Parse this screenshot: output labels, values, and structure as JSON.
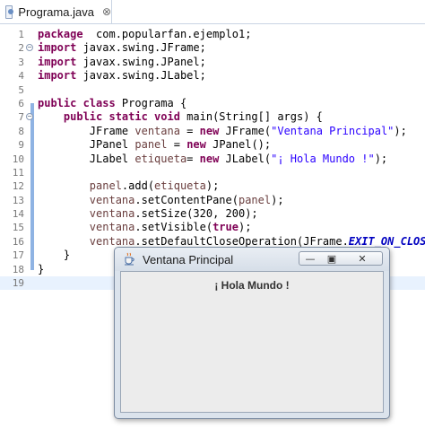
{
  "editor_tab": {
    "label": "Programa.java",
    "close_glyph": "⊗",
    "icon": "java-file-icon"
  },
  "code": {
    "lines": [
      {
        "n": "1",
        "fold": "",
        "tokens": [
          [
            "kw",
            "package"
          ],
          [
            "",
            "  com.popularfan.ejemplo1;"
          ]
        ]
      },
      {
        "n": "2",
        "fold": "−",
        "tokens": [
          [
            "kw",
            "import"
          ],
          [
            "",
            " javax.swing.JFrame;"
          ]
        ]
      },
      {
        "n": "3",
        "fold": "",
        "tokens": [
          [
            "kw",
            "import"
          ],
          [
            "",
            " javax.swing.JPanel;"
          ]
        ]
      },
      {
        "n": "4",
        "fold": "",
        "tokens": [
          [
            "kw",
            "import"
          ],
          [
            "",
            " javax.swing.JLabel;"
          ]
        ]
      },
      {
        "n": "5",
        "fold": "",
        "tokens": []
      },
      {
        "n": "6",
        "fold": "",
        "tokens": [
          [
            "kw",
            "public class"
          ],
          [
            "",
            " Programa {"
          ]
        ]
      },
      {
        "n": "7",
        "fold": "−",
        "tokens": [
          [
            "",
            "    "
          ],
          [
            "kw",
            "public static void"
          ],
          [
            "",
            " main(String[] args) {"
          ]
        ]
      },
      {
        "n": "8",
        "fold": "",
        "tokens": [
          [
            "",
            "        JFrame "
          ],
          [
            "var",
            "ventana"
          ],
          [
            "",
            " = "
          ],
          [
            "kw",
            "new"
          ],
          [
            "",
            " JFrame("
          ],
          [
            "str",
            "\"Ventana Principal\""
          ],
          [
            "",
            ");"
          ]
        ]
      },
      {
        "n": "9",
        "fold": "",
        "tokens": [
          [
            "",
            "        JPanel "
          ],
          [
            "var",
            "panel"
          ],
          [
            "",
            " = "
          ],
          [
            "kw",
            "new"
          ],
          [
            "",
            " JPanel();"
          ]
        ]
      },
      {
        "n": "10",
        "fold": "",
        "tokens": [
          [
            "",
            "        JLabel "
          ],
          [
            "var",
            "etiqueta"
          ],
          [
            "",
            "= "
          ],
          [
            "kw",
            "new"
          ],
          [
            "",
            " JLabel("
          ],
          [
            "str",
            "\"¡ Hola Mundo !\""
          ],
          [
            "",
            ");"
          ]
        ]
      },
      {
        "n": "11",
        "fold": "",
        "tokens": []
      },
      {
        "n": "12",
        "fold": "",
        "tokens": [
          [
            "",
            "        "
          ],
          [
            "var",
            "panel"
          ],
          [
            "",
            ".add("
          ],
          [
            "var",
            "etiqueta"
          ],
          [
            "",
            ");"
          ]
        ]
      },
      {
        "n": "13",
        "fold": "",
        "tokens": [
          [
            "",
            "        "
          ],
          [
            "var",
            "ventana"
          ],
          [
            "",
            ".setContentPane("
          ],
          [
            "var",
            "panel"
          ],
          [
            "",
            ");"
          ]
        ]
      },
      {
        "n": "14",
        "fold": "",
        "tokens": [
          [
            "",
            "        "
          ],
          [
            "var",
            "ventana"
          ],
          [
            "",
            ".setSize(320, 200);"
          ]
        ]
      },
      {
        "n": "15",
        "fold": "",
        "tokens": [
          [
            "",
            "        "
          ],
          [
            "var",
            "ventana"
          ],
          [
            "",
            ".setVisible("
          ],
          [
            "kw",
            "true"
          ],
          [
            "",
            ");"
          ]
        ]
      },
      {
        "n": "16",
        "fold": "",
        "tokens": [
          [
            "",
            "        "
          ],
          [
            "var",
            "ventana"
          ],
          [
            "",
            ".setDefaultCloseOperation(JFrame."
          ],
          [
            "fld",
            "EXIT_ON_CLOSE"
          ],
          [
            "",
            ");"
          ]
        ]
      },
      {
        "n": "17",
        "fold": "",
        "tokens": [
          [
            "",
            "    }"
          ]
        ]
      },
      {
        "n": "18",
        "fold": "",
        "tokens": [
          [
            "",
            "}"
          ]
        ]
      },
      {
        "n": "19",
        "fold": "",
        "tokens": []
      }
    ],
    "current_line": "19"
  },
  "swing_window": {
    "title": "Ventana Principal",
    "icon": "java-cup-icon",
    "minimize_glyph": "—",
    "maximize_glyph": "▣",
    "close_glyph": "✕",
    "label_text": "¡ Hola Mundo !"
  },
  "colors": {
    "keyword": "#7f0055",
    "string": "#2a00ff",
    "static_field": "#0000c0",
    "change_bar": "#8fb3e3",
    "current_line": "#e8f2fe"
  }
}
